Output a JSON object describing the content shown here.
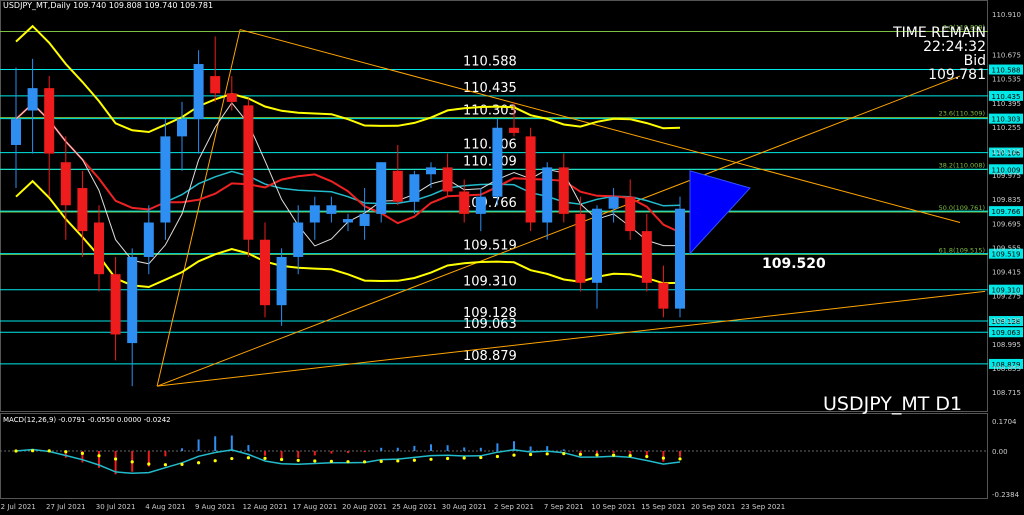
{
  "header": {
    "title": "USDJPY_MT,Daily  109.740 109.808 109.740 109.781"
  },
  "time_remain": {
    "label": "TIME REMAIN",
    "value": "22:24:32",
    "bid_label": "Bid",
    "bid_value": "109.781"
  },
  "symbol_label": "USDJPY_MT D1",
  "macd": {
    "label": "MACD(12,26,9) -0.0791 -0.0550 0.0000 -0.0242"
  },
  "colors": {
    "bull": "#2e8ef2",
    "bear": "#ee1c1c",
    "level": "#00e8e8",
    "fib": "#7fbf3f",
    "yellow": "#ffff00",
    "trend": "#ffa500"
  },
  "chart_data": {
    "type": "candlestick",
    "ylim": [
      108.6,
      110.98
    ],
    "x_labels": [
      {
        "label": "22 Jul 2021",
        "i": 0
      },
      {
        "label": "27 Jul 2021",
        "i": 3
      },
      {
        "label": "30 Jul 2021",
        "i": 6
      },
      {
        "label": "4 Aug 2021",
        "i": 9
      },
      {
        "label": "9 Aug 2021",
        "i": 12
      },
      {
        "label": "12 Aug 2021",
        "i": 15
      },
      {
        "label": "17 Aug 2021",
        "i": 18
      },
      {
        "label": "20 Aug 2021",
        "i": 21
      },
      {
        "label": "25 Aug 2021",
        "i": 24
      },
      {
        "label": "30 Aug 2021",
        "i": 27
      },
      {
        "label": "2 Sep 2021",
        "i": 30
      },
      {
        "label": "7 Sep 2021",
        "i": 33
      },
      {
        "label": "10 Sep 2021",
        "i": 36
      },
      {
        "label": "15 Sep 2021",
        "i": 39
      },
      {
        "label": "20 Sep 2021",
        "i": 42
      },
      {
        "label": "23 Sep 2021",
        "i": 45
      }
    ],
    "candles": [
      {
        "o": 110.15,
        "h": 110.6,
        "l": 109.9,
        "c": 110.3
      },
      {
        "o": 110.35,
        "h": 110.65,
        "l": 110.1,
        "c": 110.48
      },
      {
        "o": 110.48,
        "h": 110.55,
        "l": 109.85,
        "c": 110.1
      },
      {
        "o": 110.05,
        "h": 110.2,
        "l": 109.6,
        "c": 109.8
      },
      {
        "o": 109.9,
        "h": 110.0,
        "l": 109.5,
        "c": 109.65
      },
      {
        "o": 109.7,
        "h": 109.8,
        "l": 109.3,
        "c": 109.4
      },
      {
        "o": 109.4,
        "h": 109.5,
        "l": 108.9,
        "c": 109.05
      },
      {
        "o": 109.0,
        "h": 109.55,
        "l": 108.75,
        "c": 109.5
      },
      {
        "o": 109.5,
        "h": 109.8,
        "l": 109.4,
        "c": 109.7
      },
      {
        "o": 109.7,
        "h": 110.3,
        "l": 109.6,
        "c": 110.2
      },
      {
        "o": 110.2,
        "h": 110.4,
        "l": 110.0,
        "c": 110.3
      },
      {
        "o": 110.3,
        "h": 110.7,
        "l": 110.1,
        "c": 110.62
      },
      {
        "o": 110.55,
        "h": 110.78,
        "l": 110.4,
        "c": 110.45
      },
      {
        "o": 110.45,
        "h": 110.55,
        "l": 110.35,
        "c": 110.4
      },
      {
        "o": 110.38,
        "h": 110.42,
        "l": 109.5,
        "c": 109.6
      },
      {
        "o": 109.6,
        "h": 109.7,
        "l": 109.15,
        "c": 109.22
      },
      {
        "o": 109.22,
        "h": 109.55,
        "l": 109.1,
        "c": 109.5
      },
      {
        "o": 109.5,
        "h": 109.8,
        "l": 109.4,
        "c": 109.7
      },
      {
        "o": 109.7,
        "h": 109.85,
        "l": 109.6,
        "c": 109.8
      },
      {
        "o": 109.75,
        "h": 109.85,
        "l": 109.7,
        "c": 109.8
      },
      {
        "o": 109.7,
        "h": 109.75,
        "l": 109.65,
        "c": 109.72
      },
      {
        "o": 109.68,
        "h": 109.9,
        "l": 109.6,
        "c": 109.75
      },
      {
        "o": 109.75,
        "h": 110.05,
        "l": 109.7,
        "c": 110.05
      },
      {
        "o": 110.0,
        "h": 110.15,
        "l": 109.8,
        "c": 109.82
      },
      {
        "o": 109.82,
        "h": 110.0,
        "l": 109.75,
        "c": 109.98
      },
      {
        "o": 109.98,
        "h": 110.05,
        "l": 109.9,
        "c": 110.02
      },
      {
        "o": 110.02,
        "h": 110.1,
        "l": 109.85,
        "c": 109.88
      },
      {
        "o": 109.88,
        "h": 109.95,
        "l": 109.7,
        "c": 109.75
      },
      {
        "o": 109.75,
        "h": 109.9,
        "l": 109.65,
        "c": 109.85
      },
      {
        "o": 109.85,
        "h": 110.3,
        "l": 109.8,
        "c": 110.25
      },
      {
        "o": 110.25,
        "h": 110.4,
        "l": 110.2,
        "c": 110.22
      },
      {
        "o": 110.2,
        "h": 110.25,
        "l": 109.65,
        "c": 109.7
      },
      {
        "o": 109.7,
        "h": 110.05,
        "l": 109.6,
        "c": 110.02
      },
      {
        "o": 110.02,
        "h": 110.1,
        "l": 109.7,
        "c": 109.75
      },
      {
        "o": 109.75,
        "h": 109.85,
        "l": 109.3,
        "c": 109.35
      },
      {
        "o": 109.35,
        "h": 109.8,
        "l": 109.2,
        "c": 109.78
      },
      {
        "o": 109.78,
        "h": 109.9,
        "l": 109.7,
        "c": 109.85
      },
      {
        "o": 109.85,
        "h": 109.95,
        "l": 109.6,
        "c": 109.65
      },
      {
        "o": 109.65,
        "h": 109.75,
        "l": 109.3,
        "c": 109.35
      },
      {
        "o": 109.35,
        "h": 109.45,
        "l": 109.15,
        "c": 109.2
      },
      {
        "o": 109.2,
        "h": 109.85,
        "l": 109.15,
        "c": 109.78
      }
    ],
    "levels": [
      {
        "price": 110.588,
        "label": "110.588",
        "show_text": true
      },
      {
        "price": 110.435,
        "label": "110.435",
        "show_text": true
      },
      {
        "price": 110.303,
        "label": "110.303",
        "show_text": true
      },
      {
        "price": 110.106,
        "label": "110.106",
        "show_text": true
      },
      {
        "price": 110.009,
        "label": "110.009",
        "show_text": true
      },
      {
        "price": 109.766,
        "label": "109.766",
        "show_text": true
      },
      {
        "price": 109.519,
        "label": "109.519",
        "show_text": true
      },
      {
        "price": 109.31,
        "label": "109.310",
        "show_text": true
      },
      {
        "price": 109.128,
        "label": "109.128",
        "show_text": true
      },
      {
        "price": 109.063,
        "label": "109.063",
        "show_text": true
      },
      {
        "price": 108.879,
        "label": "108.879",
        "show_text": true
      }
    ],
    "fib": [
      {
        "price": 110.809,
        "label": "0.0(110.809)"
      },
      {
        "price": 110.309,
        "label": "23.6(110.309)"
      },
      {
        "price": 110.008,
        "label": "38.2(110.008)"
      },
      {
        "price": 109.761,
        "label": "50.0(109.761)"
      },
      {
        "price": 109.515,
        "label": "61.8(109.515)"
      }
    ],
    "price_ticks": [
      "110.910",
      "110.675",
      "110.535",
      "110.395",
      "110.255",
      "110.115",
      "109.975",
      "109.835",
      "109.695",
      "109.555",
      "109.415",
      "109.275",
      "109.135",
      "108.995",
      "108.855",
      "108.715"
    ],
    "macd_ticks": {
      "upper": "0.1704",
      "zero": "0.00",
      "lower": "-0.2384"
    },
    "annotation": "109.520"
  }
}
